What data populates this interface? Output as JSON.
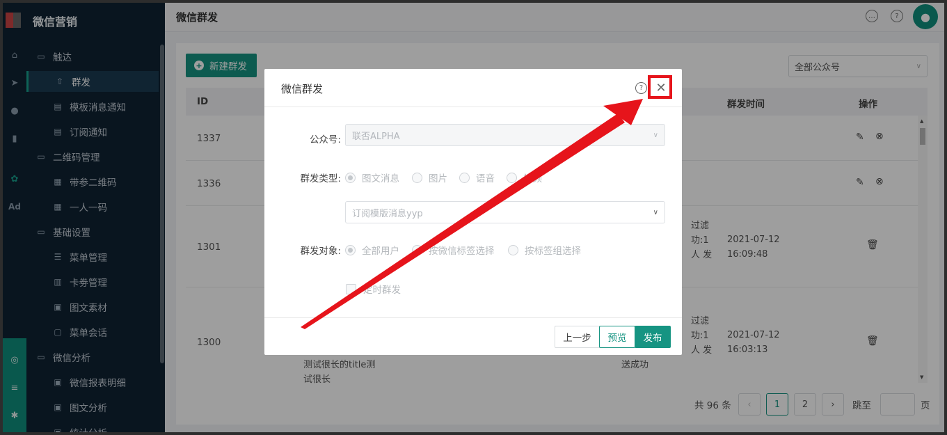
{
  "app": {
    "title": "微信营销",
    "page_title": "微信群发"
  },
  "rail_icons": [
    "home-icon",
    "send-icon",
    "user-icon",
    "chart-icon",
    "wechat-icon",
    "ad-icon",
    "network-icon",
    "server-icon",
    "gear-icon"
  ],
  "rail_text": {
    "ad": "Ad"
  },
  "sidebar": {
    "items": [
      {
        "label": "触达",
        "type": "group",
        "icon": "folder-icon"
      },
      {
        "label": "群发",
        "type": "sub",
        "icon": "broadcast-icon",
        "active": true
      },
      {
        "label": "模板消息通知",
        "type": "sub",
        "icon": "message-icon"
      },
      {
        "label": "订阅通知",
        "type": "sub",
        "icon": "message-icon"
      },
      {
        "label": "二维码管理",
        "type": "group",
        "icon": "folder-icon"
      },
      {
        "label": "带参二维码",
        "type": "sub",
        "icon": "qrcode-icon"
      },
      {
        "label": "一人一码",
        "type": "sub",
        "icon": "qrcode-icon"
      },
      {
        "label": "基础设置",
        "type": "group",
        "icon": "folder-icon"
      },
      {
        "label": "菜单管理",
        "type": "sub",
        "icon": "menu-icon"
      },
      {
        "label": "卡劵管理",
        "type": "sub",
        "icon": "coupon-icon"
      },
      {
        "label": "图文素材",
        "type": "sub",
        "icon": "document-icon"
      },
      {
        "label": "菜单会话",
        "type": "sub",
        "icon": "chat-icon"
      },
      {
        "label": "微信分析",
        "type": "group",
        "icon": "folder-icon"
      },
      {
        "label": "微信报表明细",
        "type": "sub",
        "icon": "document-icon"
      },
      {
        "label": "图文分析",
        "type": "sub",
        "icon": "document-icon"
      },
      {
        "label": "统计分析",
        "type": "sub",
        "icon": "document-icon"
      }
    ]
  },
  "toolbar": {
    "new_label": "新建群发",
    "account_select": "全部公众号"
  },
  "table": {
    "headers": {
      "id": "ID",
      "time": "群发时间",
      "op": "操作"
    },
    "rows": [
      {
        "id": "1337"
      },
      {
        "id": "1336"
      },
      {
        "id": "1301",
        "status": [
          "过滤",
          "功:1",
          "人 发"
        ],
        "time": [
          "2021-07-12",
          "16:09:48"
        ]
      },
      {
        "id": "1300",
        "status": [
          "过滤",
          "功:1",
          "人 发",
          "送成功"
        ],
        "time": [
          "2021-07-12",
          "16:03:13"
        ],
        "title": [
          "测试很长的title测",
          "试很长"
        ]
      }
    ]
  },
  "pager": {
    "total": "共 96 条",
    "pages": [
      "1",
      "2"
    ],
    "current": "1",
    "jump_label": "跳至",
    "page_suffix": "页"
  },
  "modal": {
    "title": "微信群发",
    "account_label": "公众号:",
    "account_value": "联否ALPHA",
    "type_label": "群发类型:",
    "type_options": [
      "图文消息",
      "图片",
      "语音",
      "视频"
    ],
    "type_selected": "图文消息",
    "template_value": "订阅模版消息yyp",
    "target_label": "群发对象:",
    "target_options": [
      "全部用户",
      "按微信标签选择",
      "按标签组选择"
    ],
    "target_selected": "全部用户",
    "schedule_label": "定时群发",
    "btn_prev": "上一步",
    "btn_preview": "预览",
    "btn_publish": "发布"
  },
  "colors": {
    "accent": "#169482",
    "sidebar_bg": "#0f2233",
    "highlight": "#e6141b"
  }
}
